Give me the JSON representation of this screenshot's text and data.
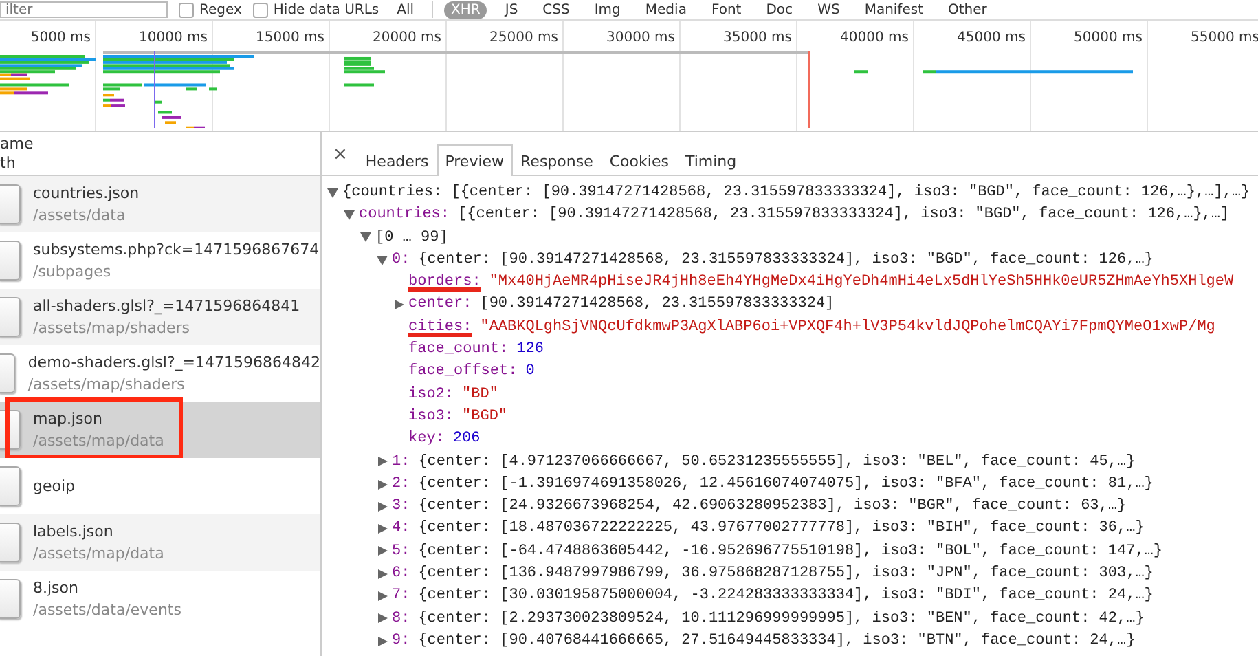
{
  "filter_bar": {
    "placeholder": "ilter",
    "checkboxes": [
      {
        "label": "Regex",
        "checked": false
      },
      {
        "label": "Hide data URLs",
        "checked": false
      }
    ],
    "types": [
      {
        "label": "All",
        "selected": false
      },
      {
        "label": "XHR",
        "selected": true
      },
      {
        "label": "JS",
        "selected": false
      },
      {
        "label": "CSS",
        "selected": false
      },
      {
        "label": "Img",
        "selected": false
      },
      {
        "label": "Media",
        "selected": false
      },
      {
        "label": "Font",
        "selected": false
      },
      {
        "label": "Doc",
        "selected": false
      },
      {
        "label": "WS",
        "selected": false
      },
      {
        "label": "Manifest",
        "selected": false
      },
      {
        "label": "Other",
        "selected": false
      }
    ]
  },
  "timeline": {
    "ticks": [
      "5000 ms",
      "10000 ms",
      "15000 ms",
      "20000 ms",
      "25000 ms",
      "30000 ms",
      "35000 ms",
      "40000 ms",
      "45000 ms",
      "50000 ms",
      "55000 ms"
    ]
  },
  "requests": {
    "name_header": "ame",
    "path_header": "th",
    "items": [
      {
        "name": "countries.json",
        "path": "/assets/data",
        "selected": false,
        "highlighted": false
      },
      {
        "name": "subsystems.php?ck=1471596867674",
        "path": "/subpages",
        "selected": false,
        "highlighted": false
      },
      {
        "name": "all-shaders.glsl?_=1471596864841",
        "path": "/assets/map/shaders",
        "selected": false,
        "highlighted": false
      },
      {
        "name": "demo-shaders.glsl?_=1471596864842",
        "path": "/assets/map/shaders",
        "selected": false,
        "highlighted": false
      },
      {
        "name": "map.json",
        "path": "/assets/map/data",
        "selected": true,
        "highlighted": true
      },
      {
        "name": "geoip",
        "selected": false,
        "highlighted": false
      },
      {
        "name": "labels.json",
        "path": "/assets/map/data",
        "selected": false,
        "highlighted": false
      },
      {
        "name": "8.json",
        "path": "/assets/data/events",
        "selected": false,
        "highlighted": false
      }
    ]
  },
  "detail": {
    "close": "×",
    "tabs": [
      {
        "label": "Headers",
        "selected": false
      },
      {
        "label": "Preview",
        "selected": true
      },
      {
        "label": "Response",
        "selected": false
      },
      {
        "label": "Cookies",
        "selected": false
      },
      {
        "label": "Timing",
        "selected": false
      }
    ],
    "tree": [
      {
        "value": "{countries: [{center: [90.39147271428568, 23.315597833333324], iso3: \"BGD\", face_count: 126,…},…],…}",
        "kind": "object",
        "expanded": true,
        "children": [
          {
            "key": "countries:",
            "value": "[{center: [90.39147271428568, 23.315597833333324], iso3: \"BGD\", face_count: 126,…},…]",
            "kind": "object",
            "expanded": true,
            "children": [
              {
                "value": "[0 … 99]",
                "kind": "object",
                "expanded": true,
                "children": [
                  {
                    "key": "0:",
                    "value": "{center: [90.39147271428568, 23.315597833333324], iso3: \"BGD\", face_count: 126,…}",
                    "kind": "object",
                    "expanded": true,
                    "children": [
                      {
                        "key": "borders:",
                        "value": "\"Mx40HjAeMR4pHiseJR4jHh8eEh4YHgMeDx4iHgYeDh4mHi4eLx5dHlYeSh5HHk0eUR5ZHmAeYh5XHlgeW",
                        "kind": "string",
                        "underlined": true
                      },
                      {
                        "key": "center:",
                        "value": "[90.39147271428568, 23.315597833333324]",
                        "kind": "object",
                        "expanded": false
                      },
                      {
                        "key": "cities:",
                        "value": "\"AABKQLghSjVNQcUfdkmwP3AgXlABP6oi+VPXQF4h+lV3P54kvldJQPohelmCQAYi7FpmQYMeO1xwP/Mg",
                        "kind": "string",
                        "underlined": true
                      },
                      {
                        "key": "face_count:",
                        "value": "126",
                        "kind": "number"
                      },
                      {
                        "key": "face_offset:",
                        "value": "0",
                        "kind": "number"
                      },
                      {
                        "key": "iso2:",
                        "value": "\"BD\"",
                        "kind": "string"
                      },
                      {
                        "key": "iso3:",
                        "value": "\"BGD\"",
                        "kind": "string"
                      },
                      {
                        "key": "key:",
                        "value": "206",
                        "kind": "number"
                      }
                    ]
                  },
                  {
                    "key": "1:",
                    "value": "{center: [4.971237066666667, 50.65231235555555], iso3: \"BEL\", face_count: 45,…}",
                    "kind": "object",
                    "expanded": false
                  },
                  {
                    "key": "2:",
                    "value": "{center: [-1.3916974691358026, 12.45616074074075], iso3: \"BFA\", face_count: 81,…}",
                    "kind": "object",
                    "expanded": false
                  },
                  {
                    "key": "3:",
                    "value": "{center: [24.9326673968254, 42.69063280952383], iso3: \"BGR\", face_count: 63,…}",
                    "kind": "object",
                    "expanded": false
                  },
                  {
                    "key": "4:",
                    "value": "{center: [18.487036722222225, 43.97677002777778], iso3: \"BIH\", face_count: 36,…}",
                    "kind": "object",
                    "expanded": false
                  },
                  {
                    "key": "5:",
                    "value": "{center: [-64.4748863605442, -16.952696775510198], iso3: \"BOL\", face_count: 147,…}",
                    "kind": "object",
                    "expanded": false
                  },
                  {
                    "key": "6:",
                    "value": "{center: [136.9487997986799, 36.975868287128755], iso3: \"JPN\", face_count: 303,…}",
                    "kind": "object",
                    "expanded": false
                  },
                  {
                    "key": "7:",
                    "value": "{center: [30.030195875000004, -3.224283333333334], iso3: \"BDI\", face_count: 24,…}",
                    "kind": "object",
                    "expanded": false
                  },
                  {
                    "key": "8:",
                    "value": "{center: [2.293730023809524, 10.111296999999995], iso3: \"BEN\", face_count: 42,…}",
                    "kind": "object",
                    "expanded": false
                  },
                  {
                    "key": "9:",
                    "value": "{center: [90.40768441666665, 27.51649445833334], iso3: \"BTN\", face_count: 24,…}",
                    "kind": "object",
                    "expanded": false
                  }
                ]
              }
            ]
          }
        ]
      }
    ]
  }
}
